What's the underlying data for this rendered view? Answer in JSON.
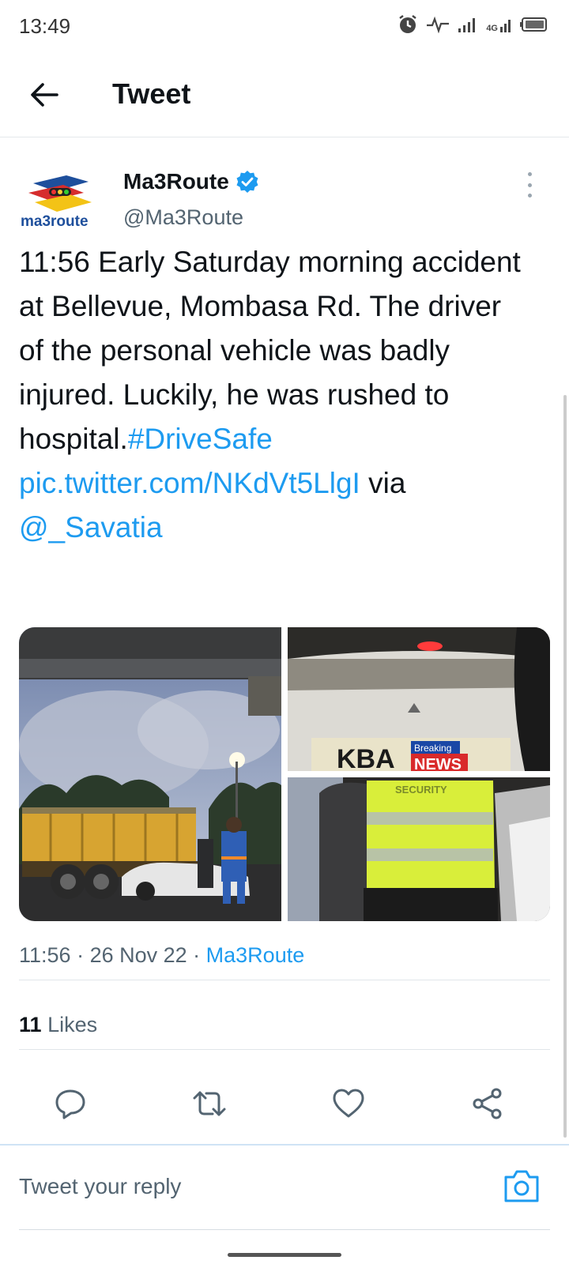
{
  "status_bar": {
    "time": "13:49",
    "network_label": "4G",
    "icons": [
      "alarm-icon",
      "activity-icon",
      "signal-icon",
      "signal-4g-icon",
      "battery-icon"
    ]
  },
  "header": {
    "title": "Tweet",
    "back_icon": "arrow-left-icon"
  },
  "tweet": {
    "author": {
      "name": "Ma3Route",
      "handle": "@Ma3Route",
      "verified": true,
      "logo_text": "ma3route"
    },
    "text_plain": "11:56 Early Saturday morning accident at Bellevue, Mombasa Rd. The driver of the personal vehicle was badly injured. Luckily, he was rushed to hospital.",
    "hashtag": "#DriveSafe",
    "pic_link": "pic.twitter.com/NKdVt5LlgI",
    "via_text": " via",
    "mention": "@_Savatia",
    "media": [
      {
        "description": "yellow truck with number 27 crashed into white car under overpass at dusk"
      },
      {
        "description": "rear of white car with plate KBA and Breaking News overlay",
        "plate_text": "KBA",
        "overlay_top": "Breaking",
        "overlay_bottom": "NEWS"
      },
      {
        "description": "person in yellow reflective security vest",
        "vest_text": "SECURITY"
      }
    ],
    "time": "11:56",
    "date": "26 Nov 22",
    "source": "Ma3Route",
    "likes_count": "11",
    "likes_label": "Likes"
  },
  "actions": [
    "reply-icon",
    "retweet-icon",
    "like-icon",
    "share-icon"
  ],
  "reply": {
    "placeholder": "Tweet your reply"
  },
  "colors": {
    "accent": "#1d9bf0",
    "text_primary": "#0f1419",
    "text_secondary": "#536471"
  }
}
